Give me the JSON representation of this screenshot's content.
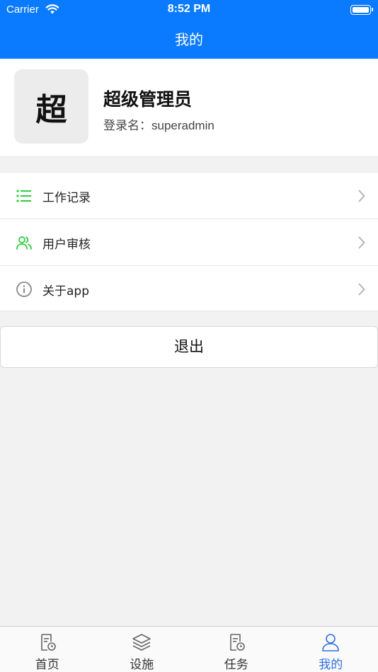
{
  "status_bar": {
    "carrier": "Carrier",
    "time": "8:52 PM"
  },
  "nav": {
    "title": "我的"
  },
  "profile": {
    "avatar_char": "超",
    "name": "超级管理员",
    "login_label": "登录名：",
    "login_value": "superadmin"
  },
  "menu": {
    "items": [
      {
        "label": "工作记录",
        "icon": "list-icon",
        "color": "#2ecc40"
      },
      {
        "label": "用户审核",
        "icon": "users-icon",
        "color": "#2ecc40"
      },
      {
        "label": "关于app",
        "icon": "info-icon",
        "color": "#888888"
      }
    ]
  },
  "logout": {
    "label": "退出"
  },
  "tabs": [
    {
      "label": "首页",
      "icon": "home-doc-icon",
      "active": false
    },
    {
      "label": "设施",
      "icon": "layers-icon",
      "active": false
    },
    {
      "label": "任务",
      "icon": "task-doc-icon",
      "active": false
    },
    {
      "label": "我的",
      "icon": "person-icon",
      "active": true
    }
  ],
  "colors": {
    "accent": "#0a7bff",
    "tab_active": "#2f6fe0",
    "menu_icon_green": "#2ecc40"
  }
}
